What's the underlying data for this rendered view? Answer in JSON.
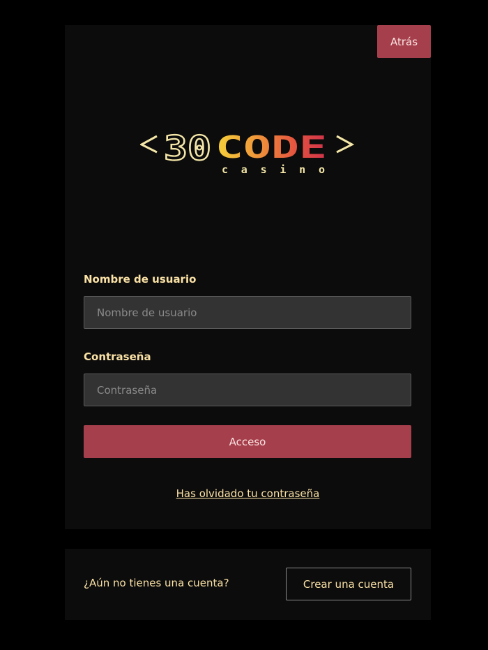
{
  "header": {
    "back_label": "Atrás"
  },
  "logo": {
    "number": "30",
    "word": "CODE",
    "subtitle": "casino"
  },
  "form": {
    "username_label": "Nombre de usuario",
    "username_placeholder": "Nombre de usuario",
    "username_value": "",
    "password_label": "Contraseña",
    "password_placeholder": "Contraseña",
    "password_value": "",
    "submit_label": "Acceso",
    "forgot_label": "Has olvidado tu contraseña"
  },
  "signup": {
    "question": "¿Aún no tienes una cuenta?",
    "button_label": "Crear una cuenta"
  },
  "colors": {
    "accent": "#a63f4c",
    "label_text": "#fbe2a6",
    "panel_bg": "#0c0c0c",
    "page_bg": "#000000",
    "input_bg": "#333333"
  },
  "icons": {
    "logo": "30code-casino-logo"
  }
}
